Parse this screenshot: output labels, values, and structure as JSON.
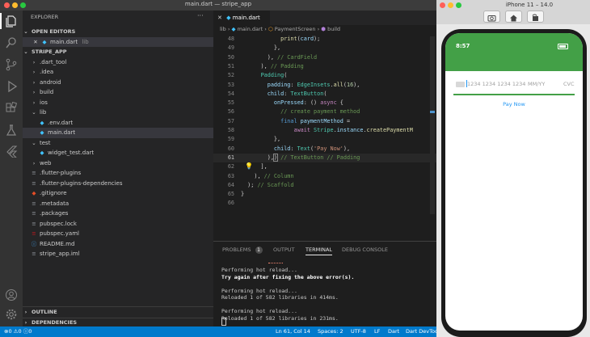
{
  "window": {
    "title": "main.dart — stripe_app"
  },
  "explorer": {
    "header": "EXPLORER",
    "more": "···",
    "open_editors": {
      "label": "OPEN EDITORS",
      "file": "main.dart",
      "path": "lib"
    },
    "project": {
      "label": "STRIPE_APP"
    },
    "tree": [
      {
        "name": ".dart_tool",
        "type": "folder",
        "depth": 1
      },
      {
        "name": ".idea",
        "type": "folder",
        "depth": 1
      },
      {
        "name": "android",
        "type": "folder",
        "depth": 1
      },
      {
        "name": "build",
        "type": "folder",
        "depth": 1
      },
      {
        "name": "ios",
        "type": "folder",
        "depth": 1
      },
      {
        "name": "lib",
        "type": "folder-open",
        "depth": 1
      },
      {
        "name": ".env.dart",
        "type": "dart",
        "depth": 2
      },
      {
        "name": "main.dart",
        "type": "dart",
        "depth": 2,
        "selected": true
      },
      {
        "name": "test",
        "type": "folder-open",
        "depth": 1
      },
      {
        "name": "widget_test.dart",
        "type": "dart",
        "depth": 2
      },
      {
        "name": "web",
        "type": "folder",
        "depth": 1
      },
      {
        "name": ".flutter-plugins",
        "type": "lines",
        "depth": 1
      },
      {
        "name": ".flutter-plugins-dependencies",
        "type": "lines",
        "depth": 1
      },
      {
        "name": ".gitignore",
        "type": "git",
        "depth": 1
      },
      {
        "name": ".metadata",
        "type": "lines",
        "depth": 1
      },
      {
        "name": ".packages",
        "type": "lines",
        "depth": 1
      },
      {
        "name": "pubspec.lock",
        "type": "lines",
        "depth": 1
      },
      {
        "name": "pubspec.yaml",
        "type": "yaml",
        "depth": 1
      },
      {
        "name": "README.md",
        "type": "info",
        "depth": 1
      },
      {
        "name": "stripe_app.iml",
        "type": "lines",
        "depth": 1
      }
    ],
    "outline": "OUTLINE",
    "dependencies": "DEPENDENCIES"
  },
  "editor": {
    "tab": "main.dart",
    "breadcrumb": {
      "b1": "lib",
      "b2": "main.dart",
      "b3": "PaymentScreen",
      "b4": "build"
    },
    "lines": [
      {
        "n": "48",
        "html": "            <span class='fn'>print</span>(<span class='prop'>card</span>);"
      },
      {
        "n": "49",
        "html": "          },"
      },
      {
        "n": "50",
        "html": "        ), <span class='cm'>// CardField</span>"
      },
      {
        "n": "51",
        "html": "      ), <span class='cm'>// Padding</span>"
      },
      {
        "n": "52",
        "html": "      <span class='cls'>Padding</span>("
      },
      {
        "n": "53",
        "html": "        <span class='prop'>padding</span>: <span class='cls'>EdgeInsets</span>.<span class='fn'>all</span>(<span class='num'>16</span>),"
      },
      {
        "n": "54",
        "html": "        <span class='prop'>child</span>: <span class='cls'>TextButton</span>("
      },
      {
        "n": "55",
        "html": "          <span class='prop'>onPressed</span>: () <span class='kw2'>async</span> {"
      },
      {
        "n": "56",
        "html": "            <span class='cm'>// create payment method</span>"
      },
      {
        "n": "57",
        "html": "            <span class='kw'>final</span> <span class='prop'>paymentMethod</span> ="
      },
      {
        "n": "58",
        "html": "                <span class='kw2'>await</span> <span class='cls'>Stripe</span>.<span class='prop'>instance</span>.<span class='fn'>createPaymentM</span>"
      },
      {
        "n": "59",
        "html": "          },"
      },
      {
        "n": "60",
        "html": "          <span class='prop'>child</span>: <span class='cls'>Text</span>(<span class='str'>'Pay Now'</span>),"
      },
      {
        "n": "61",
        "html": "        ),<span style='outline:1px solid #888'>)</span> <span class='cm'>// TextButton // Padding</span>"
      },
      {
        "n": "62",
        "html": "      ],"
      },
      {
        "n": "63",
        "html": "    ), <span class='cm'>// Column</span>"
      },
      {
        "n": "64",
        "html": "  ); <span class='cm'>// Scaffold</span>"
      },
      {
        "n": "65",
        "html": "}"
      },
      {
        "n": "66",
        "html": ""
      }
    ]
  },
  "panel": {
    "tabs": {
      "problems": "PROBLEMS",
      "problems_count": "1",
      "output": "OUTPUT",
      "terminal": "TERMINAL",
      "debug": "DEBUG CONSOLE"
    },
    "terminal": [
      {
        "text": "Performing hot reload...",
        "bold": false
      },
      {
        "text": "Try again after fixing the above error(s).",
        "bold": true
      },
      {
        "text": "",
        "bold": false
      },
      {
        "text": "Performing hot reload...",
        "bold": false
      },
      {
        "text": "Reloaded 1 of 582 libraries in 414ms.",
        "bold": false
      },
      {
        "text": "",
        "bold": false
      },
      {
        "text": "Performing hot reload...",
        "bold": false
      },
      {
        "text": "Reloaded 1 of 582 libraries in 231ms.",
        "bold": false
      }
    ]
  },
  "statusbar": {
    "errors": "0",
    "warnings": "0",
    "info": "0",
    "position": "Ln 61, Col 14",
    "spaces": "Spaces: 2",
    "encoding": "UTF-8",
    "eol": "LF",
    "language": "Dart",
    "devtools": "Dart DevTools"
  },
  "simulator": {
    "title": "iPhone 11 – 14.0",
    "time": "8:57",
    "card_placeholder": "1234 1234 1234 1234",
    "expiry_placeholder": "MM/YY",
    "cvc_placeholder": "CVC",
    "pay_button": "Pay Now",
    "colors": {
      "appbar": "#43a047",
      "button": "#2196f3"
    }
  }
}
